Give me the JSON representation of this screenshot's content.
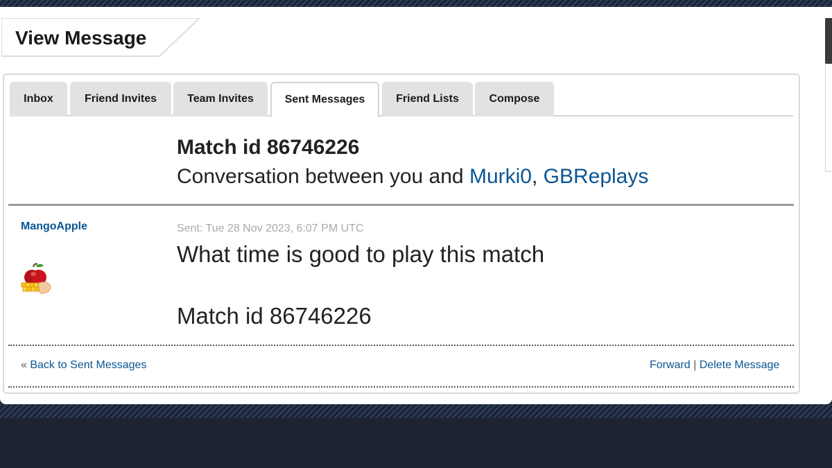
{
  "page": {
    "title": "View Message"
  },
  "tabs": [
    {
      "label": "Inbox"
    },
    {
      "label": "Friend Invites"
    },
    {
      "label": "Team Invites"
    },
    {
      "label": "Sent Messages",
      "active": true
    },
    {
      "label": "Friend Lists"
    },
    {
      "label": "Compose"
    }
  ],
  "message": {
    "subject": "Match id 86746226",
    "conversation_prefix": "Conversation between you and ",
    "participants": [
      "Murki0",
      "GBReplays"
    ],
    "participant_separator": ", ",
    "sender": "MangoApple",
    "avatar_icon": "mango-apple-icon",
    "sent": "Sent: Tue 28 Nov 2023, 6:07 PM UTC",
    "body_line_1": "What time is good to play this match",
    "body_line_2": "Match id 86746226"
  },
  "footer": {
    "back_prefix": "« ",
    "back_label": "Back to Sent Messages",
    "forward_label": "Forward",
    "separator": " | ",
    "delete_label": "Delete Message"
  },
  "colors": {
    "link": "#0b5594",
    "background": "#1d2330",
    "tab_inactive": "#e2e2e2"
  }
}
